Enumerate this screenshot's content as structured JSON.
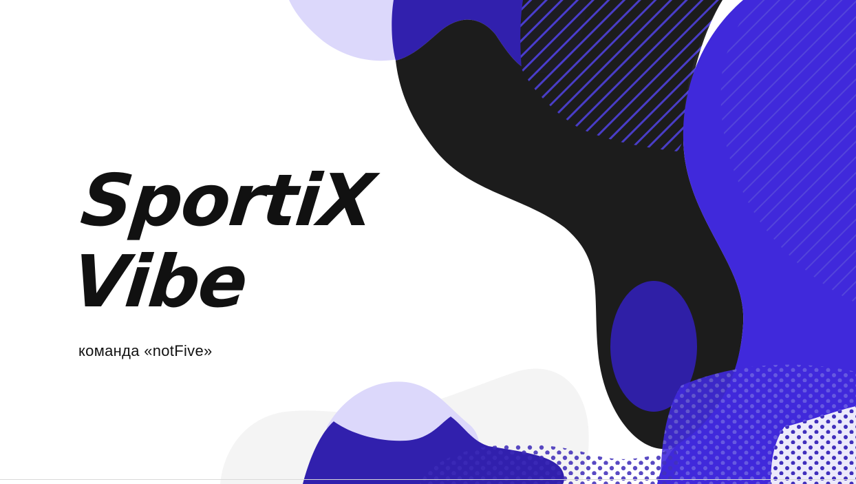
{
  "slide": {
    "title_line1": "SportiX",
    "title_line2": "Vibe",
    "subtitle": "команда «notFive»"
  },
  "colors": {
    "background": "#ffffff",
    "accent_blue": "#3f2bd9",
    "deep_blue": "#2f1fa6",
    "lavender": "#dcd8fb",
    "black_shape": "#1c1c1c",
    "light_grey_shape": "#f4f4f4",
    "dot_color": "#3c2ab8",
    "text": "#111111"
  }
}
